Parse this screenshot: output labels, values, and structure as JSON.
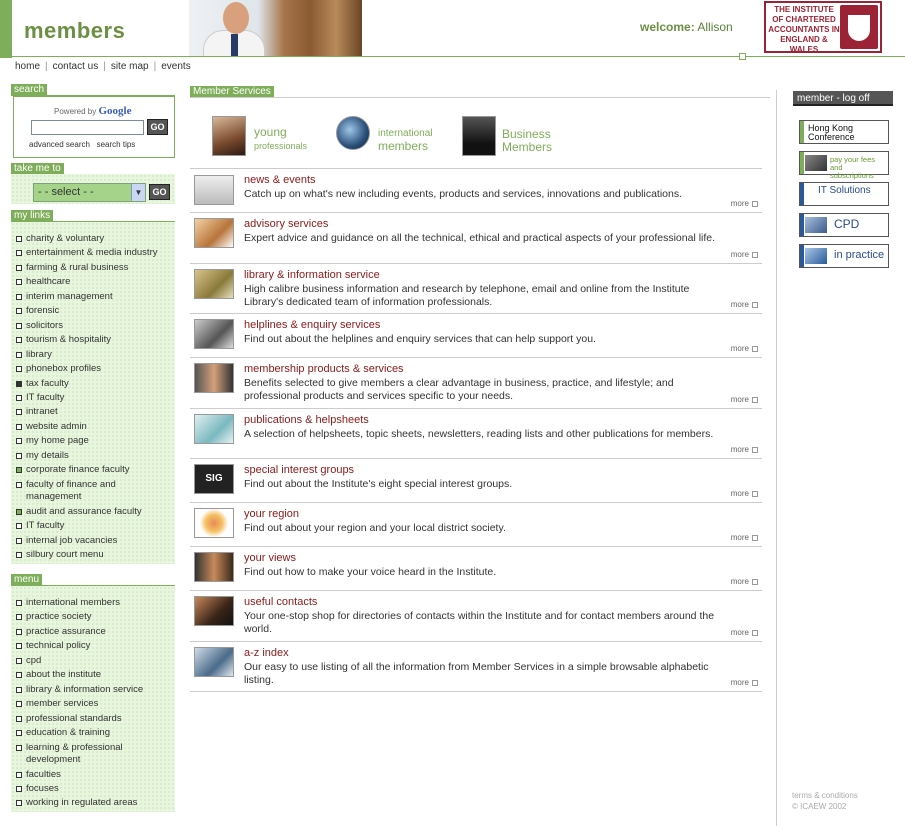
{
  "header": {
    "brand": "members",
    "welcome_label": "welcome:",
    "user_name": "Allison",
    "logo_text": "THE INSTITUTE OF CHARTERED ACCOUNTANTS IN ENGLAND & WALES"
  },
  "topnav": {
    "items": [
      "home",
      "contact us",
      "site map",
      "events"
    ]
  },
  "search": {
    "heading": "search",
    "powered_by": "Powered by",
    "google": "Google",
    "input_value": "",
    "go_label": "GO",
    "advanced": "advanced search",
    "tips": "search tips"
  },
  "take_me_to": {
    "heading": "take me to",
    "selected": "- - select - -",
    "go_label": "GO"
  },
  "my_links": {
    "heading": "my links",
    "items": [
      "charity & voluntary",
      "entertainment & media industry",
      "farming & rural business",
      "healthcare",
      "interim management",
      "forensic",
      "solicitors",
      "tourism & hospitality",
      "library",
      "phonebox profiles",
      "tax faculty",
      "IT faculty",
      "intranet",
      "website admin",
      "my home page",
      "my details",
      "corporate finance faculty",
      "faculty of finance and management",
      "audit and assurance faculty",
      "IT faculty",
      "internal job vacancies",
      "silbury court menu"
    ]
  },
  "menu": {
    "heading": "menu",
    "items": [
      "international members",
      "practice society",
      "practice assurance",
      "technical policy",
      "cpd",
      "about the institute",
      "library & information service",
      "member services",
      "professional standards",
      "education & training",
      "learning & professional development",
      "faculties",
      "focuses",
      "working in regulated areas"
    ]
  },
  "member_services": {
    "heading": "Member Services",
    "banners": [
      {
        "line1": "young",
        "line2": "professionals"
      },
      {
        "line1": "international",
        "line2": "members"
      },
      {
        "line1": "Business",
        "line2": "Members"
      }
    ],
    "more_label": "more",
    "services": [
      {
        "title": "news & events",
        "desc": "Catch up on what's new including events, products and services, innovations and publications."
      },
      {
        "title": "advisory services",
        "desc": "Expert advice and guidance on all the technical, ethical and practical aspects of your professional life."
      },
      {
        "title": "library & information service",
        "desc": "High calibre business information and research by telephone, email and online from the Institute Library's dedicated team of information professionals."
      },
      {
        "title": "helplines & enquiry services",
        "desc": "Find out about the helplines and enquiry services that can help support you."
      },
      {
        "title": "membership products & services",
        "desc": "Benefits selected to give members a clear advantage in business, practice, and lifestyle; and professional products and services specific to your needs."
      },
      {
        "title": "publications & helpsheets",
        "desc": "A selection of helpsheets, topic sheets, newsletters, reading lists and other publications for members."
      },
      {
        "title": "special interest groups",
        "desc": "Find out about the Institute's eight special interest groups.",
        "thumb_text": "SIG"
      },
      {
        "title": "your region",
        "desc": "Find out about your region and your local district society."
      },
      {
        "title": "your views",
        "desc": "Find out how to make your voice heard in the Institute."
      },
      {
        "title": "useful contacts",
        "desc": "Your one-stop shop for directories of contacts within the Institute and for contact members around the world."
      },
      {
        "title": "a-z index",
        "desc": "Our easy to use listing of all the information from Member Services in a simple browsable alphabetic listing."
      }
    ]
  },
  "right": {
    "logoff": "member - log off",
    "buttons": [
      {
        "label": "Hong Kong Conference"
      },
      {
        "label": "pay your fees and subscriptions"
      },
      {
        "label": "IT Solutions"
      },
      {
        "label": "CPD"
      },
      {
        "label": "in practice"
      }
    ],
    "terms": "terms & conditions",
    "copyright": "© ICAEW 2002"
  }
}
